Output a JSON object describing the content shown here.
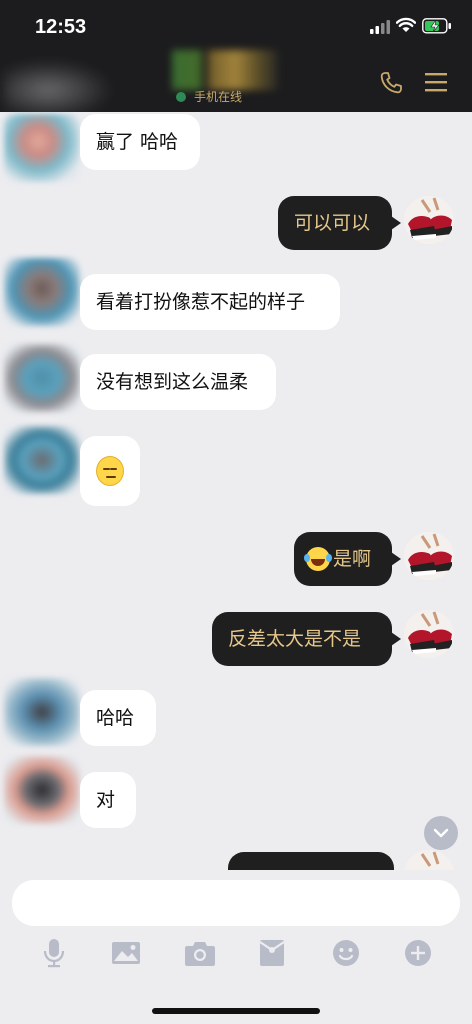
{
  "status_bar": {
    "time": "12:53"
  },
  "header": {
    "status_text": "手机在线"
  },
  "messages": [
    {
      "side": "in",
      "text": "赢了 哈哈"
    },
    {
      "side": "out",
      "text": "可以可以"
    },
    {
      "side": "in",
      "text": "看着打扮像惹不起的样子"
    },
    {
      "side": "in",
      "text": "没有想到这么温柔"
    },
    {
      "side": "in",
      "emoji": "unamused-face-emoji"
    },
    {
      "side": "out",
      "emoji": "tears-of-joy-emoji",
      "text": "是啊"
    },
    {
      "side": "out",
      "text": "反差太大是不是"
    },
    {
      "side": "in",
      "text": "哈哈"
    },
    {
      "side": "in",
      "text": "对"
    }
  ],
  "toolbar": {
    "icons": [
      "microphone-icon",
      "image-icon",
      "camera-icon",
      "red-packet-icon",
      "emoji-icon",
      "plus-icon"
    ]
  },
  "colors": {
    "header_bg": "#1c1c1e",
    "accent_gold": "#c8a96a",
    "outgoing_bubble": "#1f1f1f",
    "outgoing_text": "#e6c78a",
    "incoming_bubble": "#ffffff",
    "chat_bg": "#ededf0"
  }
}
